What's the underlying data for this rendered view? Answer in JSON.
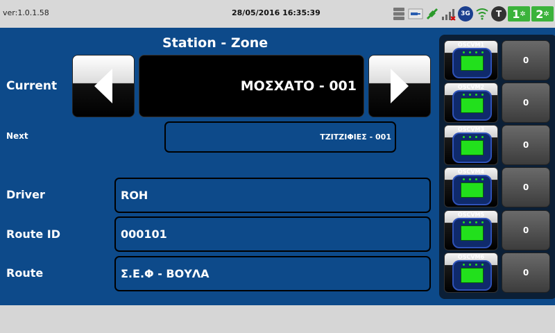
{
  "status_bar": {
    "version": "ver:1.0.1.58",
    "datetime": "28/05/2016 16:35:39",
    "icons": [
      "storage-icon",
      "usb-key-icon",
      "network-link-icon",
      "signal-strength-icon",
      "3g-icon",
      "wifi-icon",
      "tech-icon",
      "sam1-icon",
      "sam2-icon"
    ],
    "badge_3g": "3G",
    "badge_t": "T",
    "badge_1": "1",
    "badge_2": "2"
  },
  "main": {
    "title": "Station - Zone",
    "current_label": "Current",
    "current_station": "ΜΟΣΧΑΤΟ  -  001",
    "next_label": "Next",
    "next_station": "ΤΖΙΤΖΙΦΙΕΣ  -  001",
    "driver_label": "Driver",
    "driver_value": "ROH",
    "route_id_label": "Route ID",
    "route_id_value": "000101",
    "route_label": "Route",
    "route_value": "Σ.Ε.Φ - ΒΟΥΛΑ"
  },
  "validators": [
    {
      "name": "OSCVM1",
      "count": "0"
    },
    {
      "name": "OSCVM2",
      "count": "0"
    },
    {
      "name": "OSCVM3",
      "count": "0"
    },
    {
      "name": "OSCVM4",
      "count": "0"
    },
    {
      "name": "OSCVM5",
      "count": "0"
    },
    {
      "name": "OSCVM6",
      "count": "0"
    }
  ],
  "colors": {
    "panel_blue": "#0d4a8a",
    "screen_green": "#22e01c",
    "sam_green": "#3bb33b"
  }
}
